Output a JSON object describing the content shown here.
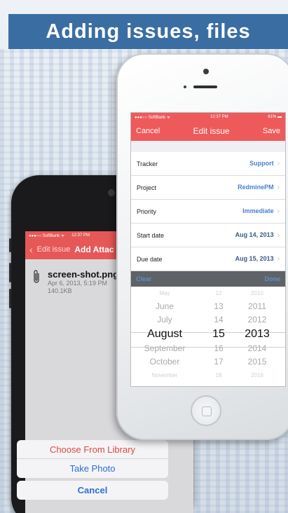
{
  "banner": {
    "title": "Adding issues, files"
  },
  "back_phone": {
    "status": {
      "carrier": "●●●○○ SoftBank ᯤ",
      "time": "12:37 PM"
    },
    "nav": {
      "back_label": "Edit issue",
      "title": "Add Attac"
    },
    "attachment": {
      "filename": "screen-shot.png",
      "date": "Apr 6, 2013, 5:19 PM",
      "size": "140.1KB",
      "icon": "paperclip-icon"
    },
    "action_sheet": {
      "options": [
        "Choose From Library",
        "Take Photo"
      ],
      "cancel": "Cancel",
      "option_color": "#e0483c",
      "alt_color": "#2a6fd6"
    }
  },
  "front_phone": {
    "status": {
      "carrier": "●●●○○ SoftBank ᯤ",
      "time": "12:37 PM",
      "battery": "61% ▬"
    },
    "nav": {
      "cancel": "Cancel",
      "title": "Edit issue",
      "save": "Save"
    },
    "form": [
      {
        "label": "Tracker",
        "value": "Support",
        "value_color": "#4a7fd0"
      },
      {
        "label": "Project",
        "value": "RedminePM",
        "value_color": "#4a7fd0"
      },
      {
        "label": "Priority",
        "value": "Immediate",
        "value_color": "#4a7fd0"
      },
      {
        "label": "Start date",
        "value": "Aug 14, 2013",
        "value_color": "#3a5a8a"
      },
      {
        "label": "Due date",
        "value": "Aug 15, 2013",
        "value_color": "#3a5a8a"
      }
    ],
    "picker_toolbar": {
      "clear": "Clear",
      "done": "Done"
    },
    "picker": {
      "months": [
        "May",
        "June",
        "July",
        "August",
        "September",
        "October",
        "November"
      ],
      "days": [
        "12",
        "13",
        "14",
        "15",
        "16",
        "17",
        "18"
      ],
      "years": [
        "2010",
        "2011",
        "2012",
        "2013",
        "2014",
        "2015",
        "2016"
      ],
      "selected_index": 3
    }
  },
  "colors": {
    "accent": "#ee5a5a",
    "banner": "#3a6ea2"
  }
}
